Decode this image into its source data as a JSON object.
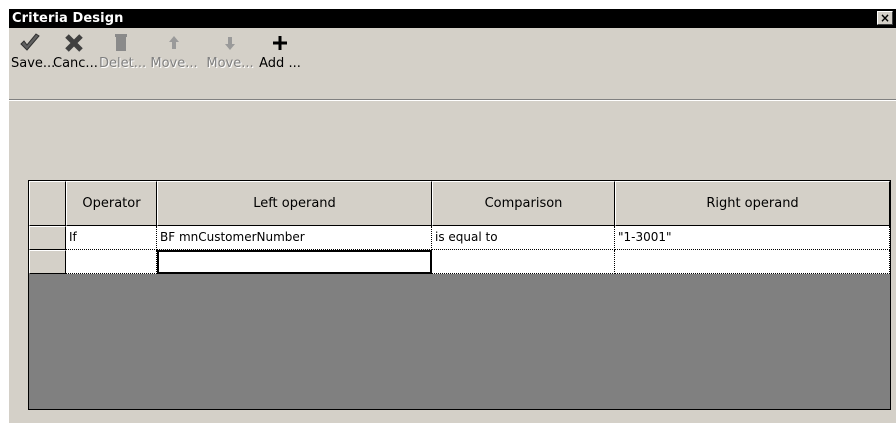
{
  "window": {
    "title": "Criteria Design",
    "close_glyph": "×"
  },
  "toolbar": {
    "buttons": [
      {
        "label": "Save...",
        "icon": "check-icon",
        "enabled": true
      },
      {
        "label": "Canc...",
        "icon": "x-cancel-icon",
        "enabled": true
      },
      {
        "label": "Delet...",
        "icon": "trash-icon",
        "enabled": false
      },
      {
        "label": "Move...",
        "icon": "arrow-up-icon",
        "enabled": false
      },
      {
        "label": "Move...",
        "icon": "arrow-down-icon",
        "enabled": false
      },
      {
        "label": "Add ...",
        "icon": "plus-icon",
        "enabled": true
      }
    ]
  },
  "grid": {
    "columns": [
      "Operator",
      "Left operand",
      "Comparison",
      "Right operand"
    ],
    "rows": [
      [
        "If",
        "BF mnCustomerNumber",
        "is equal to",
        "\"1-3001\""
      ],
      [
        "",
        "",
        "",
        ""
      ]
    ]
  }
}
